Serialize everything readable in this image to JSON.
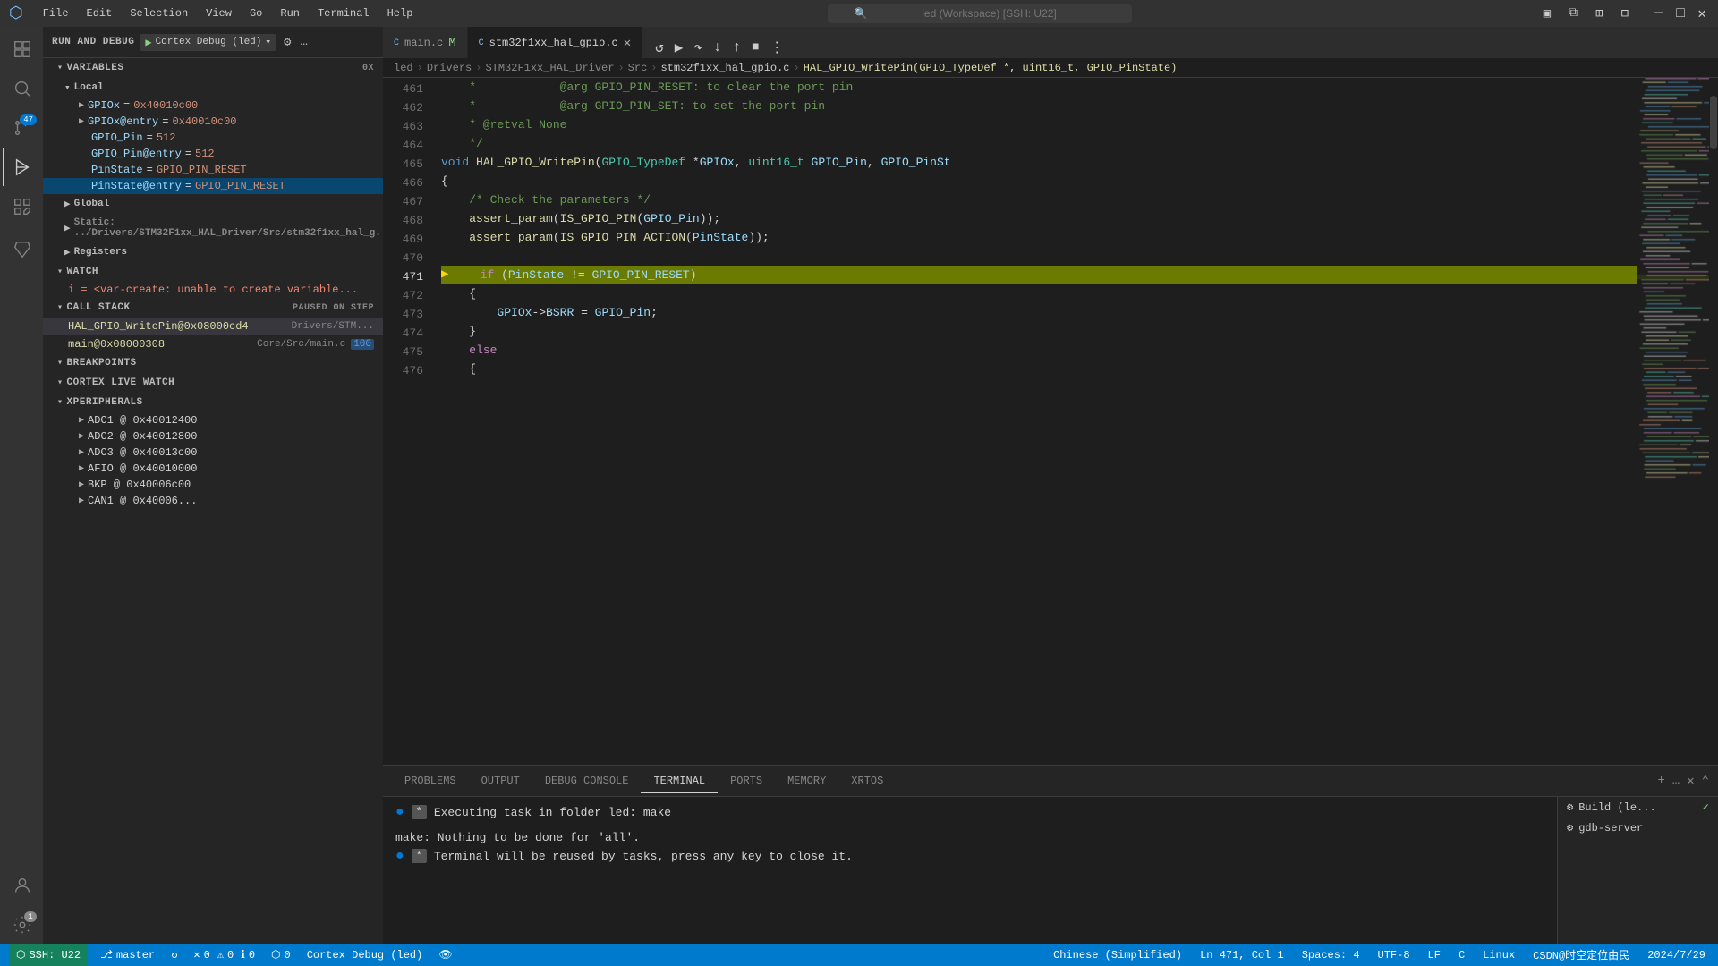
{
  "titlebar": {
    "menu_items": [
      "File",
      "Edit",
      "Selection",
      "View",
      "Go",
      "Run",
      "Terminal",
      "Help"
    ],
    "search_placeholder": "led (Workspace) [SSH: U22]",
    "logo": "⬡",
    "win_minimize": "─",
    "win_restore": "□",
    "win_close": "✕"
  },
  "debug_toolbar": {
    "label": "RUN AND DEBUG",
    "play_icon": "▶",
    "config_name": "Cortex Debug (led)",
    "settings_icon": "⚙",
    "more_icon": "…"
  },
  "debug_controls": {
    "continue": "⟳",
    "step_over": "↷",
    "step_into": "↓",
    "step_out": "↑",
    "restart": "↺",
    "stop": "□"
  },
  "variables": {
    "section_label": "VARIABLES",
    "hex_label": "0x",
    "local_label": "Local",
    "items": [
      {
        "name": "GPIOx",
        "value": "0x40010c00",
        "indent": 1
      },
      {
        "name": "GPIOx@entry",
        "value": "0x40010c00",
        "indent": 1
      },
      {
        "name": "GPIO_Pin",
        "value": "512",
        "indent": 1
      },
      {
        "name": "GPIO_Pin@entry",
        "value": "512",
        "indent": 1
      },
      {
        "name": "PinState",
        "value": "GPIO_PIN_RESET",
        "indent": 1
      },
      {
        "name": "PinState@entry",
        "value": "GPIO_PIN_RESET",
        "indent": 1
      }
    ],
    "global_label": "Global",
    "static_label": "Static: ../Drivers/STM32F1xx_HAL_Driver/Src/stm32f1xx_hal_g...",
    "registers_label": "Registers"
  },
  "watch": {
    "section_label": "WATCH",
    "items": [
      {
        "text": "i = <var-create: unable to create variable..."
      }
    ]
  },
  "call_stack": {
    "section_label": "CALL STACK",
    "paused_label": "Paused on step",
    "items": [
      {
        "name": "HAL_GPIO_WritePin@0x08000cd4",
        "location": "Drivers/STM...",
        "line": null,
        "selected": true
      },
      {
        "name": "main@0x08000308",
        "location": "Core/Src/main.c",
        "line": "100"
      }
    ]
  },
  "breakpoints": {
    "section_label": "BREAKPOINTS"
  },
  "cortex_live_watch": {
    "section_label": "CORTEX LIVE WATCH"
  },
  "xperipherals": {
    "section_label": "XPERIPHERALS",
    "items": [
      {
        "name": "ADC1 @ 0x40012400"
      },
      {
        "name": "ADC2 @ 0x40012800"
      },
      {
        "name": "ADC3 @ 0x40013c00"
      },
      {
        "name": "AFIO @ 0x40010000"
      },
      {
        "name": "BKP @ 0x40006c00"
      },
      {
        "name": "CAN1 @ 0x40006..."
      }
    ]
  },
  "tabs": [
    {
      "label": "main.c",
      "icon": "C",
      "modified": "M",
      "active": false
    },
    {
      "label": "stm32f1xx_hal_gpio.c",
      "icon": "C",
      "active": true
    }
  ],
  "breadcrumb": {
    "items": [
      "led",
      "Drivers",
      "STM32F1xx_HAL_Driver",
      "Src"
    ],
    "file": "stm32f1xx_hal_gpio.c",
    "func": "HAL_GPIO_WritePin(GPIO_TypeDef *, uint16_t, GPIO_PinState)"
  },
  "code": {
    "lines": [
      {
        "num": 461,
        "content": [
          {
            "t": "    * ",
            "c": "cmt"
          },
          {
            "t": "           @arg GPIO_PIN_RESET: to clear the port pin",
            "c": "cmt"
          }
        ]
      },
      {
        "num": 462,
        "content": [
          {
            "t": "    * ",
            "c": "cmt"
          },
          {
            "t": "           @arg GPIO_PIN_SET: to set the port pin",
            "c": "cmt"
          }
        ]
      },
      {
        "num": 463,
        "content": [
          {
            "t": "    * @retval None",
            "c": "cmt"
          }
        ]
      },
      {
        "num": 464,
        "content": [
          {
            "t": "    */",
            "c": "cmt"
          }
        ]
      },
      {
        "num": 465,
        "content": [
          {
            "t": "void ",
            "c": "kw"
          },
          {
            "t": "HAL_GPIO_WritePin",
            "c": "fn"
          },
          {
            "t": "(",
            "c": "punct"
          },
          {
            "t": "GPIO_TypeDef",
            "c": "type"
          },
          {
            "t": " *",
            "c": "op"
          },
          {
            "t": "GPIOx",
            "c": "param"
          },
          {
            "t": ", ",
            "c": "punct"
          },
          {
            "t": "uint16_t",
            "c": "type"
          },
          {
            "t": " ",
            "c": ""
          },
          {
            "t": "GPIO_Pin",
            "c": "param"
          },
          {
            "t": ", ",
            "c": "punct"
          },
          {
            "t": "GPIO_PinSt",
            "c": "param"
          }
        ]
      },
      {
        "num": 466,
        "content": [
          {
            "t": "{",
            "c": "punct"
          }
        ]
      },
      {
        "num": 467,
        "content": [
          {
            "t": "    /* Check the parameters */",
            "c": "cmt"
          }
        ]
      },
      {
        "num": 468,
        "content": [
          {
            "t": "    ",
            "c": ""
          },
          {
            "t": "assert_param",
            "c": "fn"
          },
          {
            "t": "(",
            "c": "punct"
          },
          {
            "t": "IS_GPIO_PIN",
            "c": "macro"
          },
          {
            "t": "(",
            "c": "punct"
          },
          {
            "t": "GPIO_Pin",
            "c": "param"
          },
          {
            "t": "));",
            "c": "punct"
          }
        ]
      },
      {
        "num": 469,
        "content": [
          {
            "t": "    ",
            "c": ""
          },
          {
            "t": "assert_param",
            "c": "fn"
          },
          {
            "t": "(",
            "c": "punct"
          },
          {
            "t": "IS_GPIO_PIN_ACTION",
            "c": "macro"
          },
          {
            "t": "(",
            "c": "punct"
          },
          {
            "t": "PinState",
            "c": "param"
          },
          {
            "t": "));",
            "c": "punct"
          }
        ]
      },
      {
        "num": 470,
        "content": []
      },
      {
        "num": 471,
        "content": [
          {
            "t": "    ",
            "c": ""
          },
          {
            "t": "if",
            "c": "kw2"
          },
          {
            "t": " (",
            "c": "punct"
          },
          {
            "t": "PinState",
            "c": "param"
          },
          {
            "t": " != ",
            "c": "op"
          },
          {
            "t": "GPIO_PIN_RESET",
            "c": "param"
          },
          {
            "t": ")",
            "c": "punct"
          }
        ],
        "highlighted": true,
        "arrow": true
      },
      {
        "num": 472,
        "content": [
          {
            "t": "    {",
            "c": "punct"
          }
        ]
      },
      {
        "num": 473,
        "content": [
          {
            "t": "        ",
            "c": ""
          },
          {
            "t": "GPIOx",
            "c": "param"
          },
          {
            "t": "->",
            "c": "op"
          },
          {
            "t": "BSRR",
            "c": "param"
          },
          {
            "t": " = ",
            "c": "op"
          },
          {
            "t": "GPIO_Pin",
            "c": "param"
          },
          {
            "t": ";",
            "c": "punct"
          }
        ]
      },
      {
        "num": 474,
        "content": [
          {
            "t": "    }",
            "c": "punct"
          }
        ]
      },
      {
        "num": 475,
        "content": [
          {
            "t": "    ",
            "c": ""
          },
          {
            "t": "else",
            "c": "kw2"
          }
        ]
      },
      {
        "num": 476,
        "content": [
          {
            "t": "    {",
            "c": "punct"
          }
        ]
      }
    ]
  },
  "terminal": {
    "tabs": [
      "PROBLEMS",
      "OUTPUT",
      "DEBUG CONSOLE",
      "TERMINAL",
      "PORTS",
      "MEMORY",
      "XRTOS"
    ],
    "active_tab": "TERMINAL",
    "lines": [
      {
        "type": "task",
        "text": "Executing task in folder led: make"
      },
      {
        "type": "blank"
      },
      {
        "type": "plain",
        "text": "make: Nothing to be done for 'all'."
      },
      {
        "type": "task",
        "text": "Terminal will be reused by tasks, press any key to close it."
      }
    ],
    "side_panel": {
      "items": [
        {
          "label": "Build (le...",
          "checked": true
        },
        {
          "label": "gdb-server",
          "checked": false
        }
      ]
    }
  },
  "status_bar": {
    "ssh": "SSH: U22",
    "branch": "master",
    "sync_icon": "↻",
    "errors": "0",
    "warnings": "0",
    "infos": "0",
    "debug_icon": "⬡",
    "debug_label": "0",
    "cortex": "Cortex Debug (led)",
    "language": "Chinese (Simplified)",
    "encoding": "UTF-8",
    "line_ending": "LF",
    "lang_c": "C",
    "platform": "Linux",
    "position": "Ln 471, Col 1",
    "spaces": "Spaces: 4",
    "csdn_logo": "CSDN@时空定位由民",
    "date": "2024/7/29"
  }
}
